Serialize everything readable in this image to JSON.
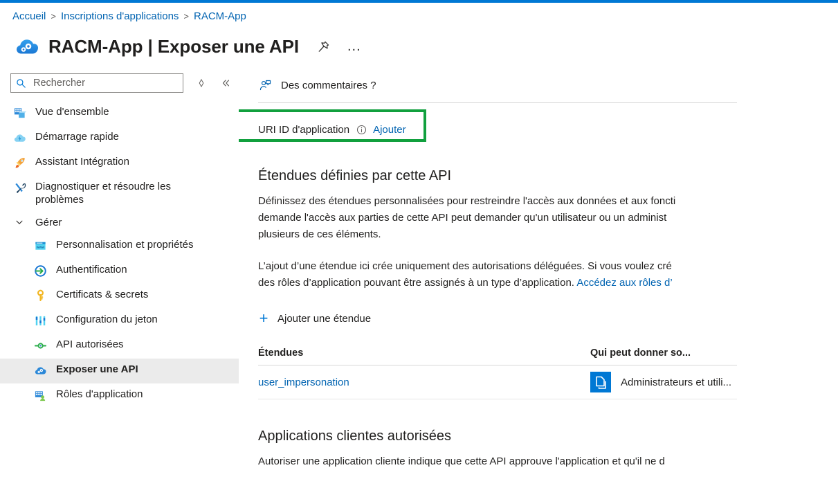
{
  "theme": {
    "accent_blue": "#0078d4",
    "link_blue": "#0063b1",
    "annotation_green": "#11a03e",
    "selected_row_bg": "#ebebeb"
  },
  "top_bar": {
    "color": "#0078d4"
  },
  "breadcrumb": {
    "items": [
      {
        "label": "Accueil"
      },
      {
        "label": "Inscriptions d'applications"
      },
      {
        "label": "RACM-App"
      }
    ],
    "separator": ">"
  },
  "header": {
    "icon": "cloud-gears-icon",
    "title": "RACM-App | Exposer une API",
    "pin_icon": "pin-icon",
    "more_icon": "ellipsis-icon",
    "more_label": "..."
  },
  "sidebar": {
    "search": {
      "placeholder": "Rechercher",
      "value": "",
      "icon": "search-icon"
    },
    "tools": [
      {
        "name": "resize-handle-icon",
        "glyph": "diamond"
      },
      {
        "name": "collapse-chevrons-icon",
        "glyph": "«"
      }
    ],
    "items": [
      {
        "label": "Vue d'ensemble",
        "icon": "overview-grid-icon",
        "selected": false,
        "sub": false
      },
      {
        "label": "Démarrage rapide",
        "icon": "quickstart-cloud-icon",
        "selected": false,
        "sub": false
      },
      {
        "label": "Assistant Intégration",
        "icon": "rocket-icon",
        "selected": false,
        "sub": false
      },
      {
        "label": "Diagnostiquer et résoudre les problèmes",
        "icon": "troubleshoot-tools-icon",
        "selected": false,
        "sub": false
      }
    ],
    "group": {
      "label": "Gérer",
      "chevron": "chevron-down-icon",
      "items": [
        {
          "label": "Personnalisation et propriétés",
          "icon": "branding-www-icon",
          "selected": false
        },
        {
          "label": "Authentification",
          "icon": "authentication-arrow-icon",
          "selected": false
        },
        {
          "label": "Certificats & secrets",
          "icon": "key-icon",
          "selected": false
        },
        {
          "label": "Configuration du jeton",
          "icon": "token-sliders-icon",
          "selected": false
        },
        {
          "label": "API autorisées",
          "icon": "api-permissions-icon",
          "selected": false
        },
        {
          "label": "Exposer une API",
          "icon": "cloud-gears-icon",
          "selected": true
        },
        {
          "label": "Rôles d'application",
          "icon": "app-roles-icon",
          "selected": false
        }
      ]
    }
  },
  "main": {
    "feedback": {
      "label": "Des commentaires ?",
      "icon": "feedback-person-icon"
    },
    "app_id_uri": {
      "label": "URI ID d'application",
      "info_icon": "info-icon",
      "action_label": "Ajouter",
      "highlighted": true
    },
    "scopes_section": {
      "title": "Étendues définies par cette API",
      "paragraph_1_lines": [
        "Définissez des étendues personnalisées pour restreindre l'accès aux données et aux foncti",
        "demande l'accès aux parties de cette API peut demander qu'un utilisateur ou un administ",
        "plusieurs de ces éléments."
      ],
      "paragraph_2_lines": [
        "L’ajout d’une étendue ici crée uniquement des autorisations déléguées. Si vous voulez cré",
        "des rôles d’application pouvant être assignés à un type d’application. "
      ],
      "paragraph_2_link": "Accédez aux rôles d’",
      "add_scope_label": "Ajouter une étendue",
      "add_scope_icon": "plus-icon",
      "table": {
        "columns": [
          "Étendues",
          "Qui peut donner so..."
        ],
        "rows": [
          {
            "scope": "user_impersonation",
            "copy_icon": "copy-icon",
            "consent": "Administrateurs et utili..."
          }
        ]
      }
    },
    "client_apps_section": {
      "title": "Applications clientes autorisées",
      "paragraph": "Autoriser une application cliente indique que cette API approuve l'application et qu'il ne d"
    }
  }
}
